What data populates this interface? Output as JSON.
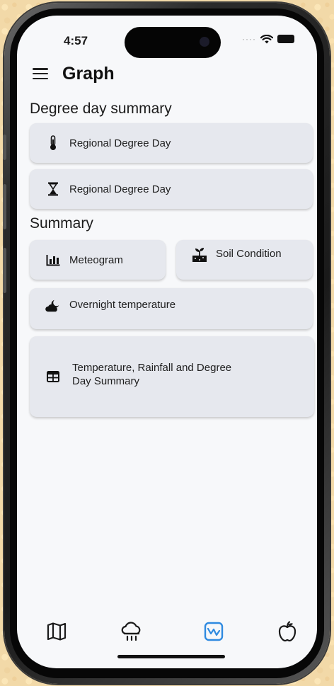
{
  "status_bar": {
    "time": "4:57",
    "signal_dots": "····"
  },
  "header": {
    "title": "Graph",
    "menu_icon": "hamburger-menu-icon"
  },
  "sections": {
    "degree_day_summary": {
      "title": "Degree day summary",
      "items": [
        {
          "label": "Regional Degree Day",
          "icon": "thermometer-icon"
        },
        {
          "label": "Regional Degree Day",
          "icon": "hourglass-icon"
        }
      ]
    },
    "summary": {
      "title": "Summary",
      "items": [
        {
          "label": "Meteogram",
          "icon": "bar-chart-icon"
        },
        {
          "label": "Soil Condition",
          "icon": "seedling-soil-icon"
        },
        {
          "label": "Overnight temperature",
          "icon": "cloud-moon-icon"
        },
        {
          "label": "Temperature, Rainfall and Degree\n Day Summary",
          "icon": "table-icon"
        }
      ]
    }
  },
  "tab_bar": {
    "active_index": 2,
    "active_color": "#2f8ae0",
    "inactive_color": "#1a1a1a",
    "tabs": [
      {
        "icon": "map-icon"
      },
      {
        "icon": "rain-cloud-icon"
      },
      {
        "icon": "graph-icon"
      },
      {
        "icon": "apple-icon"
      }
    ]
  }
}
